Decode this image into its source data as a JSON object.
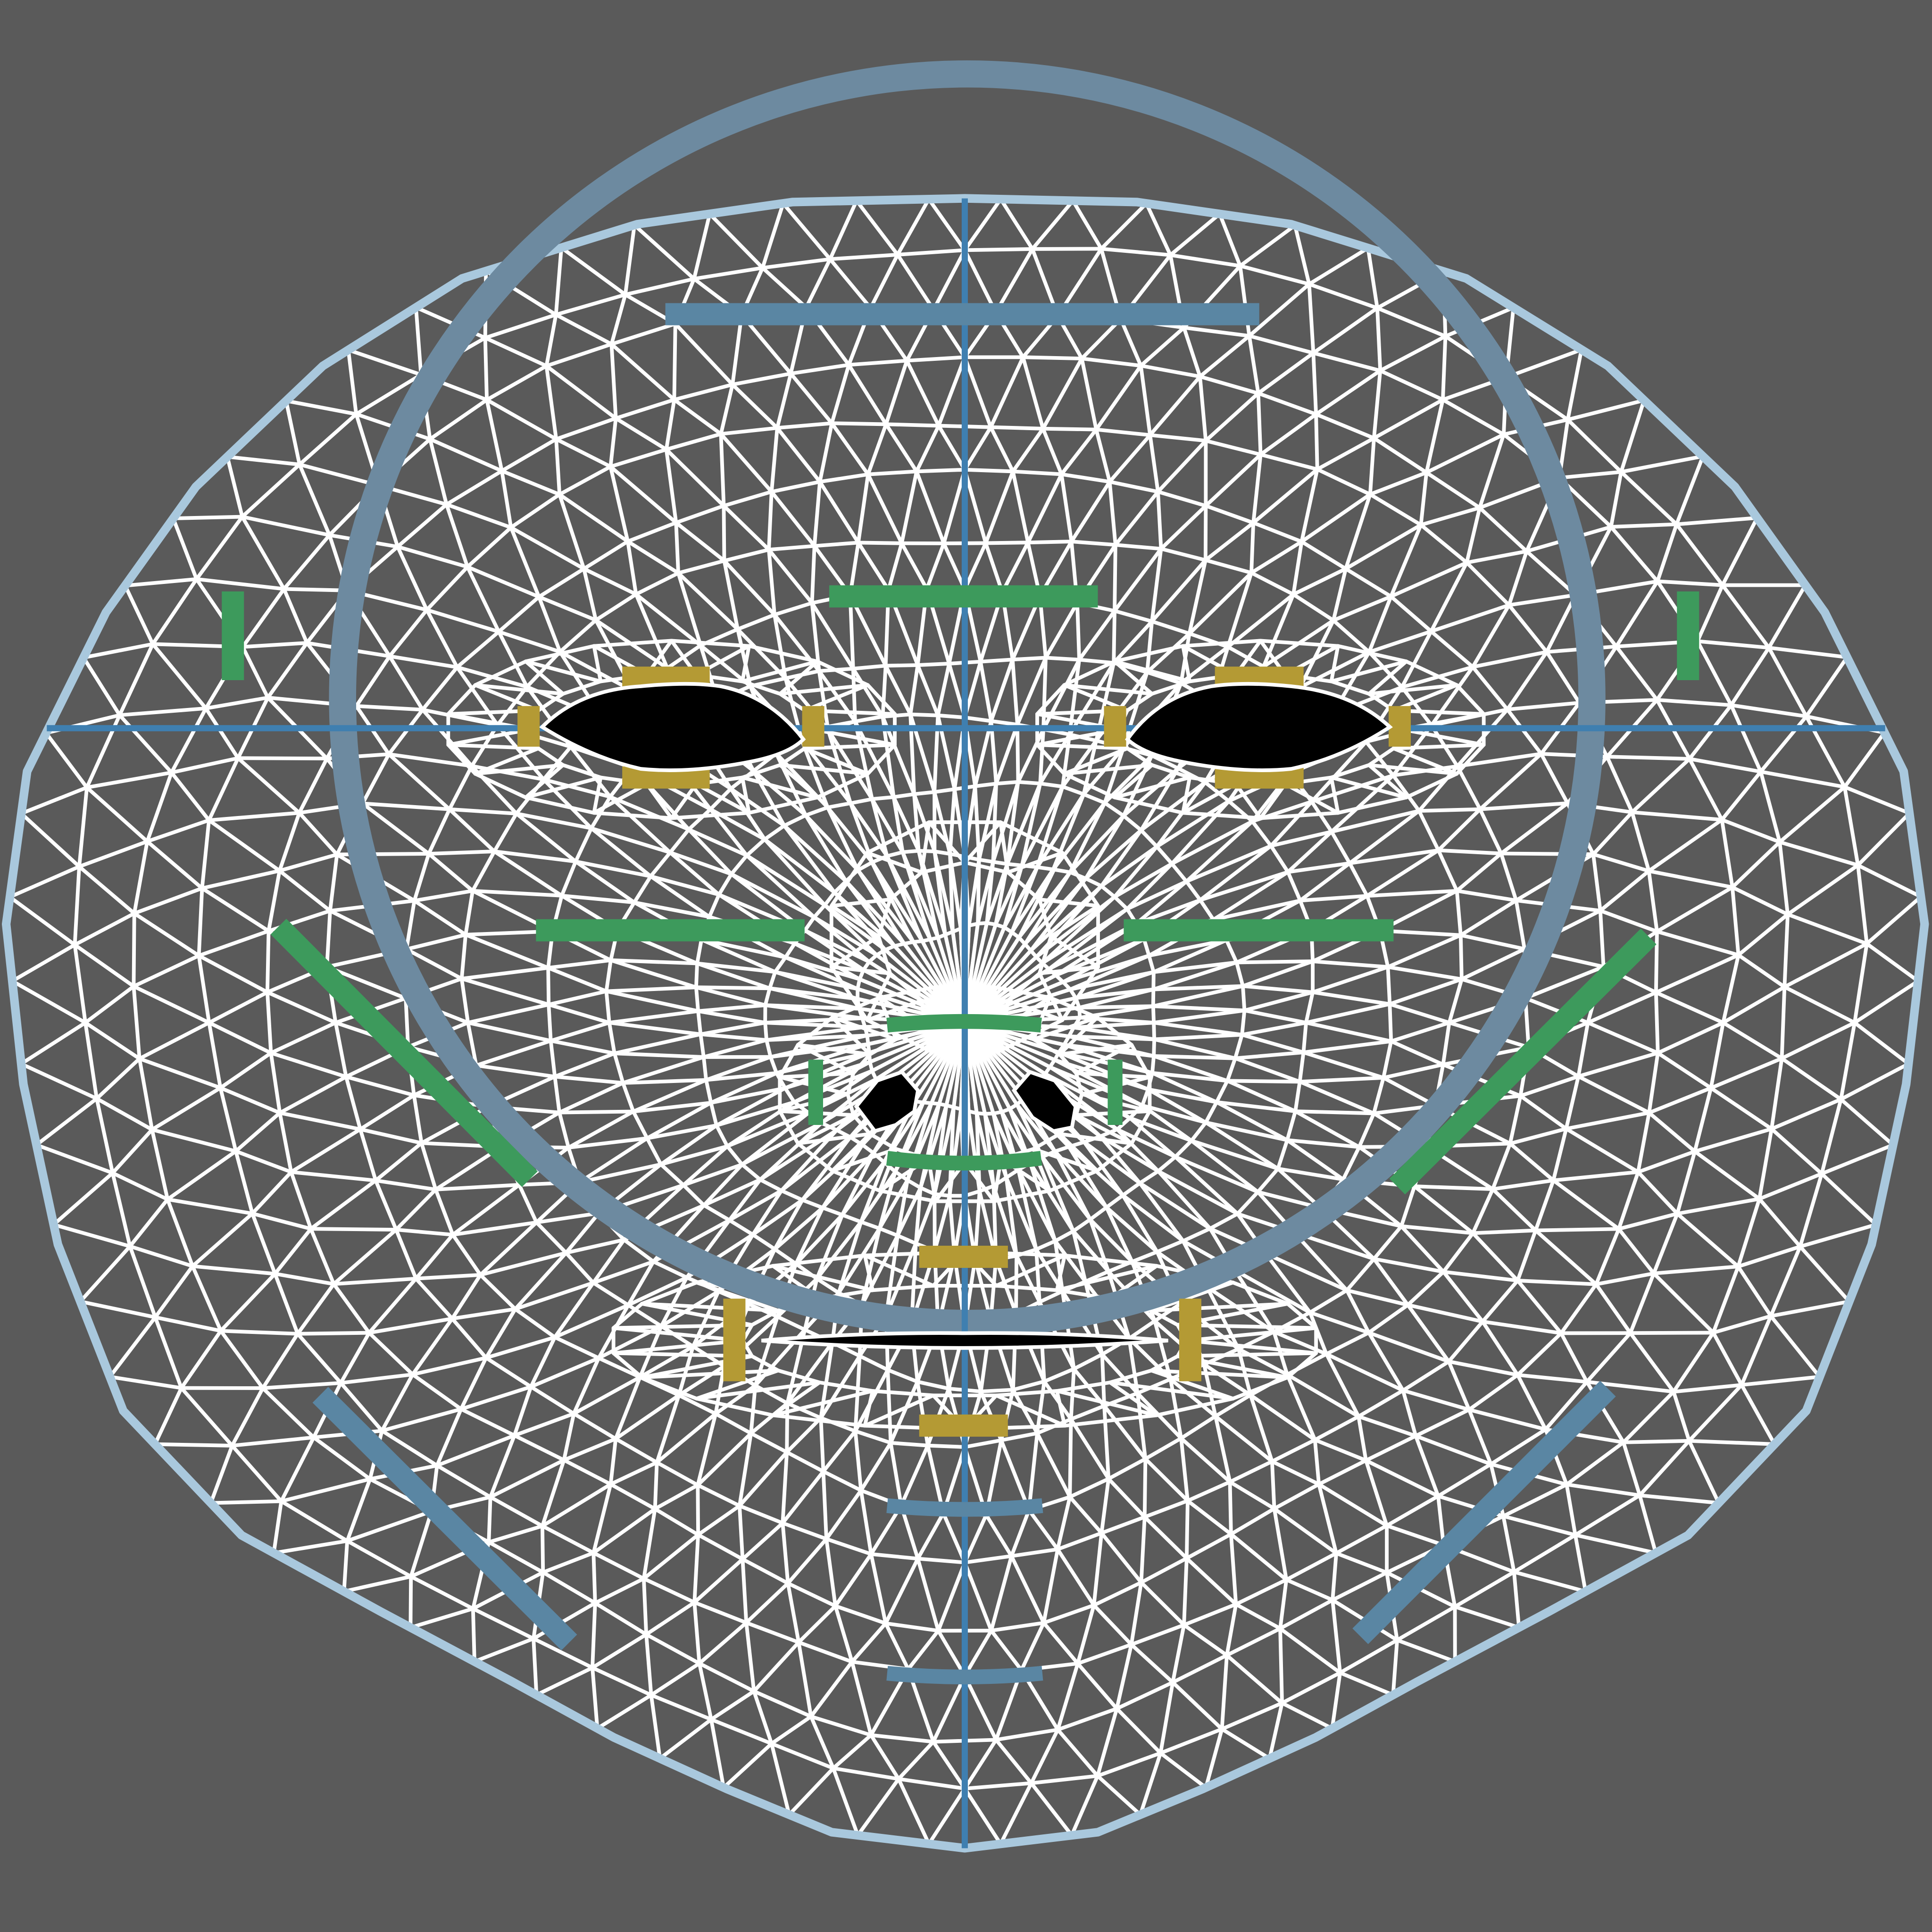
{
  "colors": {
    "background": "#5a5a5a",
    "mesh": "#ffffff",
    "outline": "#a9c8dd",
    "circle": "#6d8aa0",
    "axis": "#3f7fb0",
    "guide_blue": "#5a86a3",
    "guide_green": "#3d9a5c",
    "guide_yellow": "#b49a34",
    "feature_fill": "#000000"
  },
  "features": [
    "left-eye",
    "right-eye",
    "left-nostril",
    "right-nostril",
    "mouth"
  ]
}
